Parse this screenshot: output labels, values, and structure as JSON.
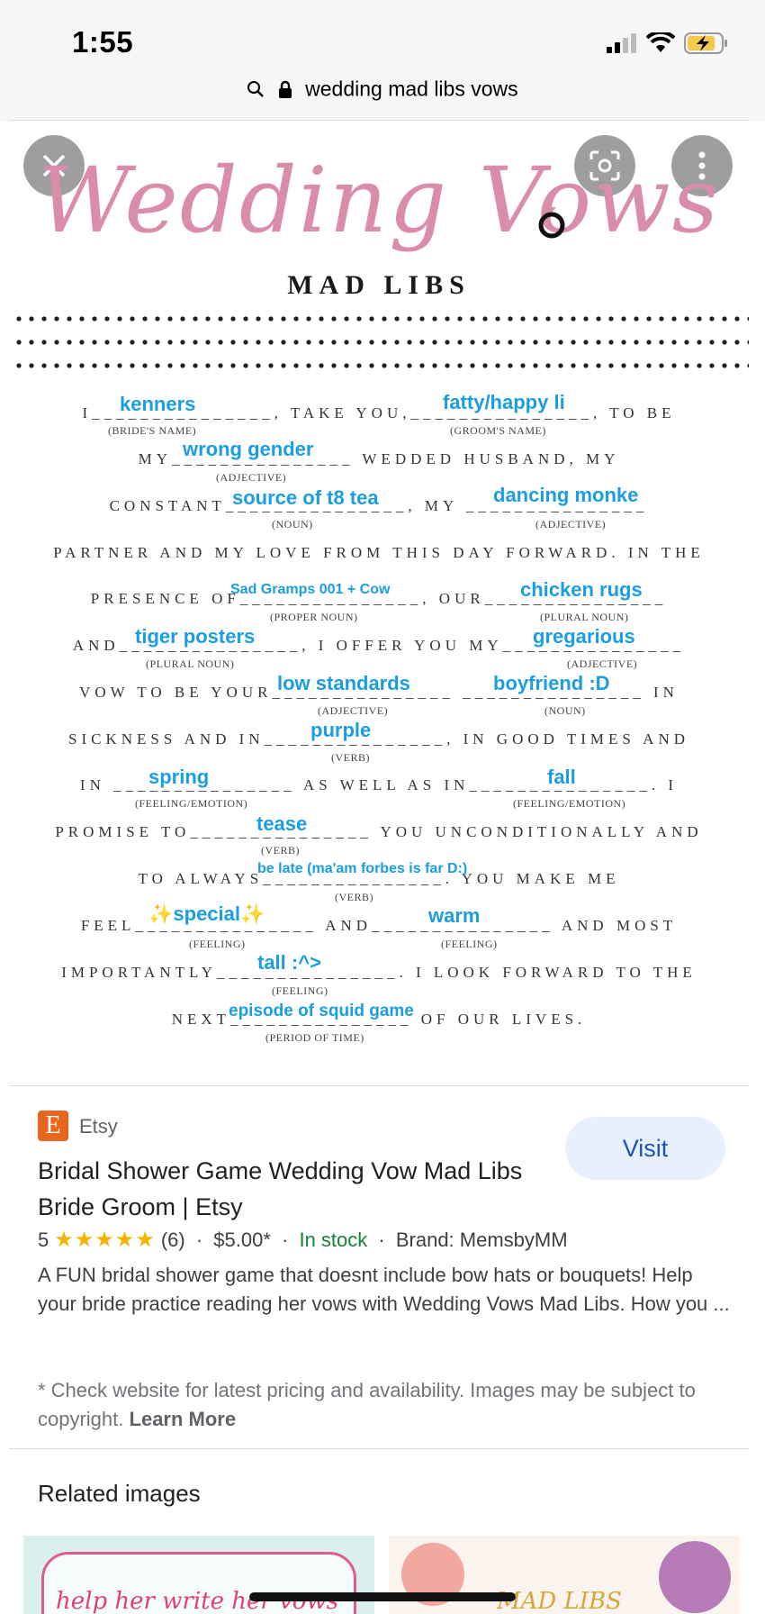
{
  "status": {
    "time": "1:55"
  },
  "url": {
    "text": "wedding mad libs vows"
  },
  "viewer": {
    "title": "Wedding Vows",
    "subtitle": "MAD LIBS",
    "lines": [
      "I_______________, TAKE YOU,_______________, TO BE",
      "MY_______________ WEDDED HUSBAND, MY",
      "CONSTANT_______________, MY _______________",
      "PARTNER AND MY LOVE FROM THIS DAY FORWARD. IN THE",
      "PRESENCE OF_______________, OUR_______________",
      "AND_______________, I OFFER YOU MY_______________",
      "VOW TO BE YOUR_______________ _______________ IN",
      "SICKNESS AND IN_______________, IN GOOD TIMES AND",
      "IN _______________ AS WELL AS IN_______________. I",
      "PROMISE TO_______________ YOU UNCONDITIONALLY AND",
      "TO ALWAYS_______________. YOU MAKE ME",
      "FEEL_______________ AND_______________ AND MOST",
      "IMPORTANTLY_______________. I LOOK FORWARD TO THE",
      "NEXT_______________ OF OUR LIVES."
    ],
    "sublabels": {
      "brides_name": "(BRIDE'S NAME)",
      "grooms_name": "(GROOM'S NAME)",
      "adjective1": "(ADJECTIVE)",
      "noun1": "(NOUN)",
      "adjective2": "(ADJECTIVE)",
      "proper_noun": "(PROPER NOUN)",
      "plural_noun1": "(PLURAL NOUN)",
      "plural_noun2": "(PLURAL NOUN)",
      "adjective3": "(ADJECTIVE)",
      "adjective4": "(ADJECTIVE)",
      "noun2": "(NOUN)",
      "verb1": "(VERB)",
      "feeling_emotion1": "(FEELING/EMOTION)",
      "feeling_emotion2": "(FEELING/EMOTION)",
      "verb2": "(VERB)",
      "verb3": "(VERB)",
      "feeling1": "(FEELING)",
      "feeling2": "(FEELING)",
      "feeling3": "(FEELING)",
      "period_of_time": "(PERIOD OF TIME)"
    },
    "fills": {
      "brides_name": "kenners",
      "grooms_name": "fatty/happy li",
      "adjective1": "wrong gender",
      "noun1": "source of t8 tea",
      "adjective2": "dancing monke",
      "proper_noun": "Sad Gramps 001 + Cow",
      "plural_noun1": "chicken rugs",
      "plural_noun2": "tiger posters",
      "adjective3": "gregarious",
      "adjective4": "low standards",
      "noun2": "boyfriend :D",
      "verb1": "purple",
      "feeling_emotion1": "spring",
      "feeling_emotion2": "fall",
      "verb2": "tease",
      "verb3": "be late (ma'am forbes is far D:)",
      "feeling1": "✨special✨",
      "feeling2": "warm",
      "feeling3": "tall :^>",
      "period_of_time": "episode of squid game"
    }
  },
  "result": {
    "source": "Etsy",
    "source_logo_letter": "E",
    "visit_label": "Visit",
    "title": "Bridal Shower Game Wedding Vow Mad Libs Bride Groom | Etsy",
    "rating": "5",
    "stars": "★★★★★",
    "reviews": "(6)",
    "price": "$5.00*",
    "stock": "In stock",
    "brand": "Brand: MemsbyMM",
    "description": "A FUN bridal shower game that doesnt include bow hats or bouquets! Help your bride practice reading her vows with Wedding Vows Mad Libs. How you ...",
    "disclaimer": "* Check website for latest pricing and availability. Images may be subject to copyright.",
    "learn_more": "Learn More"
  },
  "related": {
    "title": "Related images",
    "thumb1_text": "help her write her vows",
    "thumb2_text": "MAD LIBS"
  },
  "colors": {
    "fill_text": "#1b9de2",
    "title_pink": "#d98cab",
    "etsy_orange": "#e8661f",
    "visit_bg": "#e8f0fe"
  }
}
